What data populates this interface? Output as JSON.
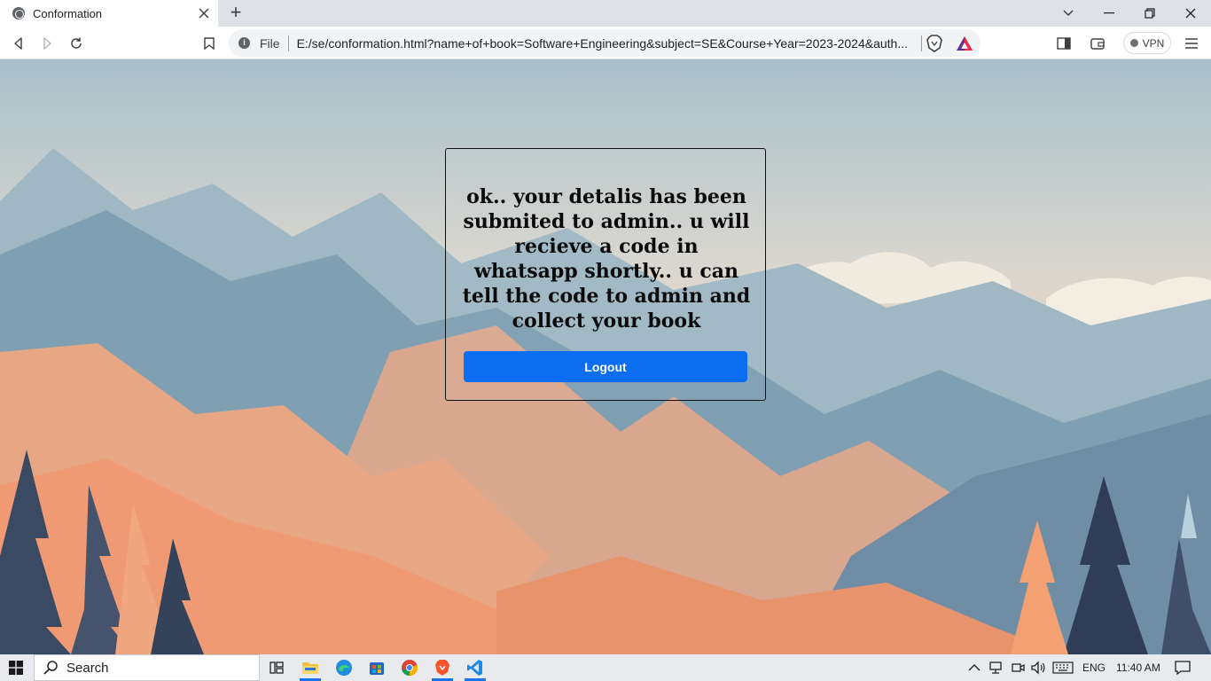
{
  "browser": {
    "tab_title": "Conformation",
    "new_tab_symbol": "+",
    "url_scheme": "File",
    "url": "E:/se/conformation.html?name+of+book=Software+Engineering&subject=SE&Course+Year=2023-2024&auth...",
    "vpn_label": "VPN",
    "icons": [
      "globe-icon",
      "close-icon",
      "plus-icon",
      "back-icon",
      "forward-icon",
      "reload-icon",
      "bookmark-icon",
      "info-icon",
      "brave-shield-icon",
      "brave-rewards-icon",
      "sidebar-icon",
      "wallet-icon",
      "menu-icon",
      "minimize-icon",
      "maximize-icon",
      "window-close-icon"
    ]
  },
  "page": {
    "message": "ok.. your detalis has been submited to admin.. u will recieve a code in whatsapp shortly.. u can tell the code to admin and collect your book",
    "button_label": "Logout",
    "accent_color": "#0a6df2"
  },
  "taskbar": {
    "search_label": "Search",
    "language": "ENG",
    "time": "11:40 AM",
    "apps": [
      "task-view-icon",
      "file-explorer-icon",
      "edge-icon",
      "store-icon",
      "chrome-icon",
      "brave-icon",
      "vscode-icon"
    ]
  }
}
